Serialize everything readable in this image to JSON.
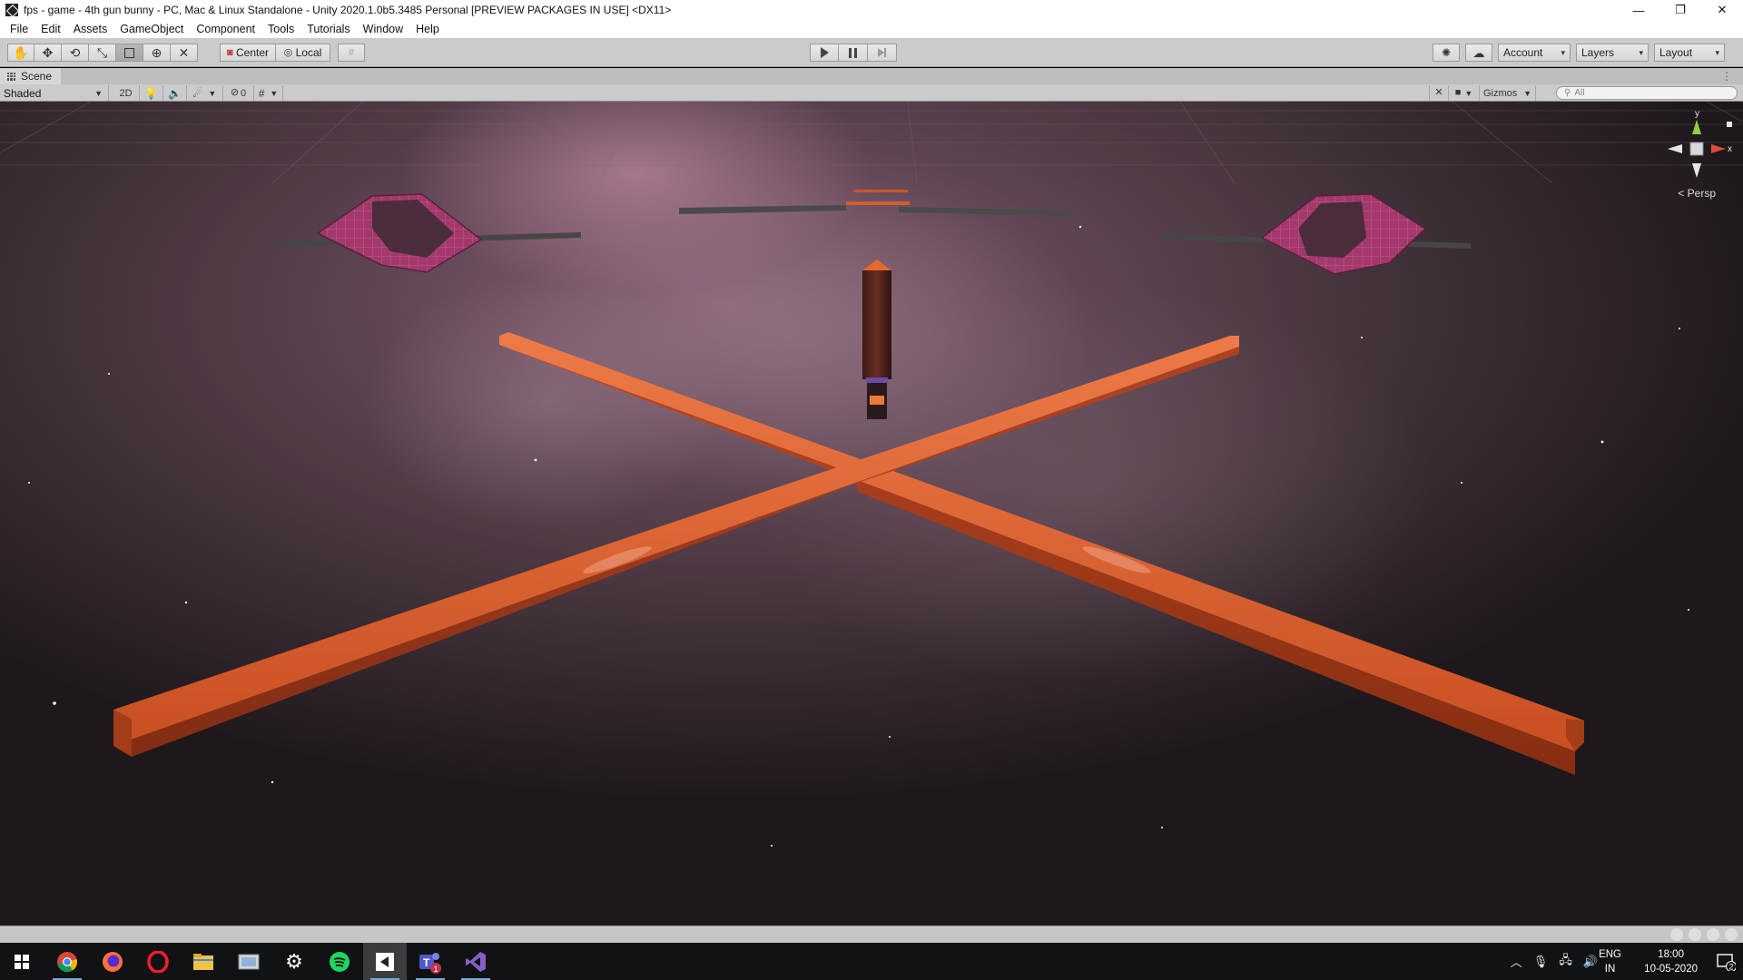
{
  "window": {
    "title": "fps - game - 4th gun bunny - PC, Mac & Linux Standalone - Unity 2020.1.0b5.3485 Personal [PREVIEW PACKAGES IN USE] <DX11>",
    "minimize_glyph": "—",
    "restore_glyph": "❐",
    "close_glyph": "✕"
  },
  "menu": [
    "File",
    "Edit",
    "Assets",
    "GameObject",
    "Component",
    "Tools",
    "Tutorials",
    "Window",
    "Help"
  ],
  "toolbar": {
    "pivot_label": "Center",
    "space_label": "Local",
    "account_label": "Account",
    "layers_label": "Layers",
    "layout_label": "Layout"
  },
  "scene_tab": {
    "label": "Scene"
  },
  "scene_controls": {
    "draw_mode": "Shaded",
    "mode_2d": "2D",
    "hidden_count": "0",
    "gizmos_label": "Gizmos",
    "search_placeholder": "All"
  },
  "viewport": {
    "projection_label": "Persp",
    "gizmo_y": "y",
    "gizmo_x": "x",
    "colors": {
      "beam": "#d9582b",
      "platform": "#a0366a",
      "sky": "#3a2a33"
    }
  },
  "taskbar": {
    "apps": [
      "windows-start",
      "chrome",
      "firefox",
      "opera",
      "file-explorer",
      "photos",
      "settings",
      "spotify",
      "unity",
      "teams",
      "visual-studio"
    ],
    "teams_badge": "1",
    "lang_top": "ENG",
    "lang_bottom": "IN",
    "time": "18:00",
    "date": "10-05-2020",
    "notifications": "2"
  }
}
